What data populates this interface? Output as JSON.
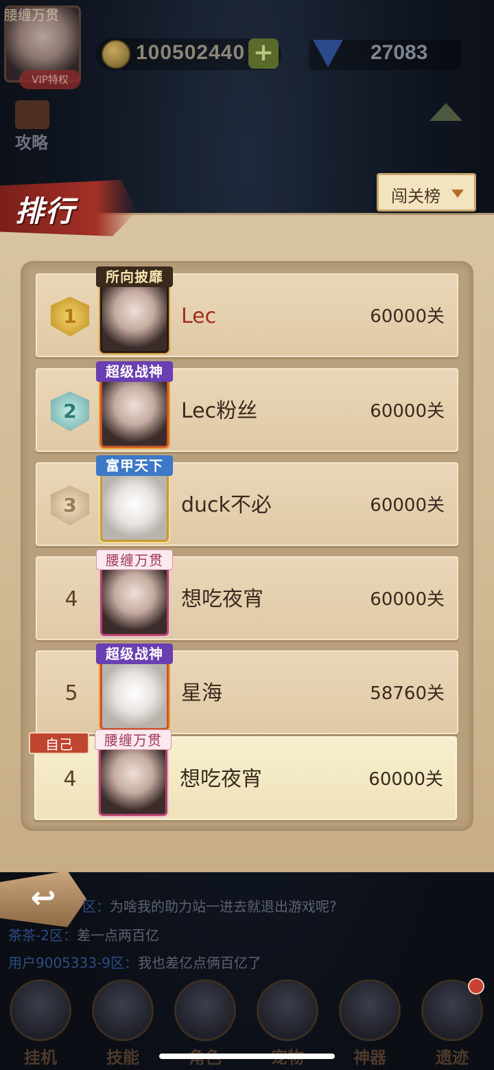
{
  "topbar": {
    "avatar_title": "腰缠万贯",
    "vip_label": "VIP特权",
    "gold": "100502440",
    "plus": "+",
    "gems": "27083",
    "guide_label": "攻略"
  },
  "panel": {
    "title": "排行",
    "dropdown_label": "闯关榜",
    "self_tag": "自己"
  },
  "rows": [
    {
      "rank": "1",
      "title": "所向披靡",
      "name": "Lec",
      "score": "60000关"
    },
    {
      "rank": "2",
      "title": "超级战神",
      "name": "Lec粉丝",
      "score": "60000关"
    },
    {
      "rank": "3",
      "title": "富甲天下",
      "name": "duck不必",
      "score": "60000关"
    },
    {
      "rank": "4",
      "title": "腰缠万贯",
      "name": "想吃夜宵",
      "score": "60000关"
    },
    {
      "rank": "5",
      "title": "超级战神",
      "name": "星海",
      "score": "58760关"
    },
    {
      "rank": "4",
      "title": "腰缠万贯",
      "name": "想吃夜宵",
      "score": "60000关"
    }
  ],
  "chat": [
    {
      "user": "区：",
      "msg": "为啥我的助力站一进去就退出游戏呢?"
    },
    {
      "user": "茶茶-2区：",
      "msg": "差一点两百亿"
    },
    {
      "user": "用户9005333-9区：",
      "msg": "我也差亿点俩百亿了"
    }
  ],
  "nav": [
    "挂机",
    "技能",
    "角色",
    "宠物",
    "神器",
    "遗迹"
  ],
  "back_glyph": "↩",
  "colors": {
    "accent_red": "#a02d1d",
    "panel": "#d9c4a1",
    "self_row": "#f7efcf"
  }
}
